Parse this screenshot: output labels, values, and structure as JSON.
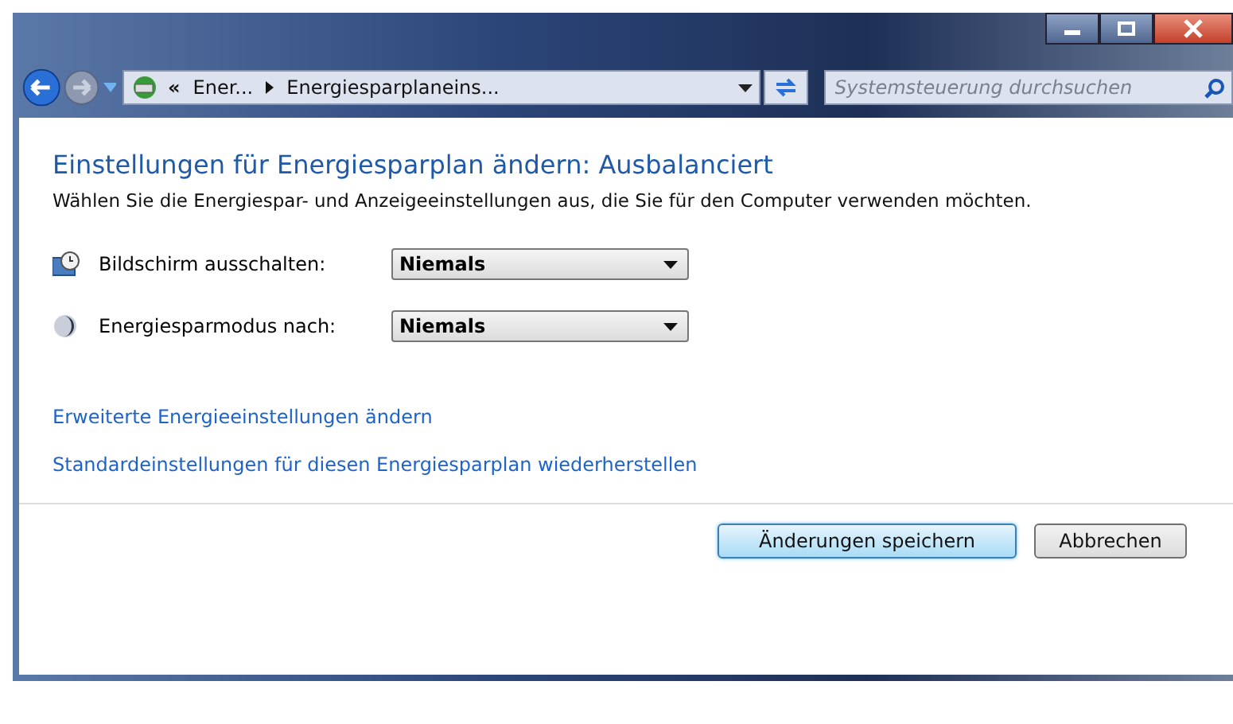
{
  "address_bar": {
    "overflow": "«",
    "crumbs": [
      "Ener...",
      "Energiesparplaneins..."
    ]
  },
  "search": {
    "placeholder": "Systemsteuerung durchsuchen"
  },
  "heading": "Einstellungen für Energiesparplan ändern: Ausbalanciert",
  "description": "Wählen Sie die Energiespar- und Anzeigeeinstellungen aus, die Sie für den Computer verwenden möchten.",
  "settings": [
    {
      "kind": "display",
      "label": "Bildschirm ausschalten:",
      "value": "Niemals"
    },
    {
      "kind": "sleep",
      "label": "Energiesparmodus nach:",
      "value": "Niemals"
    }
  ],
  "links": [
    "Erweiterte Energieeinstellungen ändern",
    "Standardeinstellungen für diesen Energiesparplan wiederherstellen"
  ],
  "buttons": [
    {
      "label": "Änderungen speichern",
      "default": true
    },
    {
      "label": "Abbrechen",
      "default": false
    }
  ]
}
